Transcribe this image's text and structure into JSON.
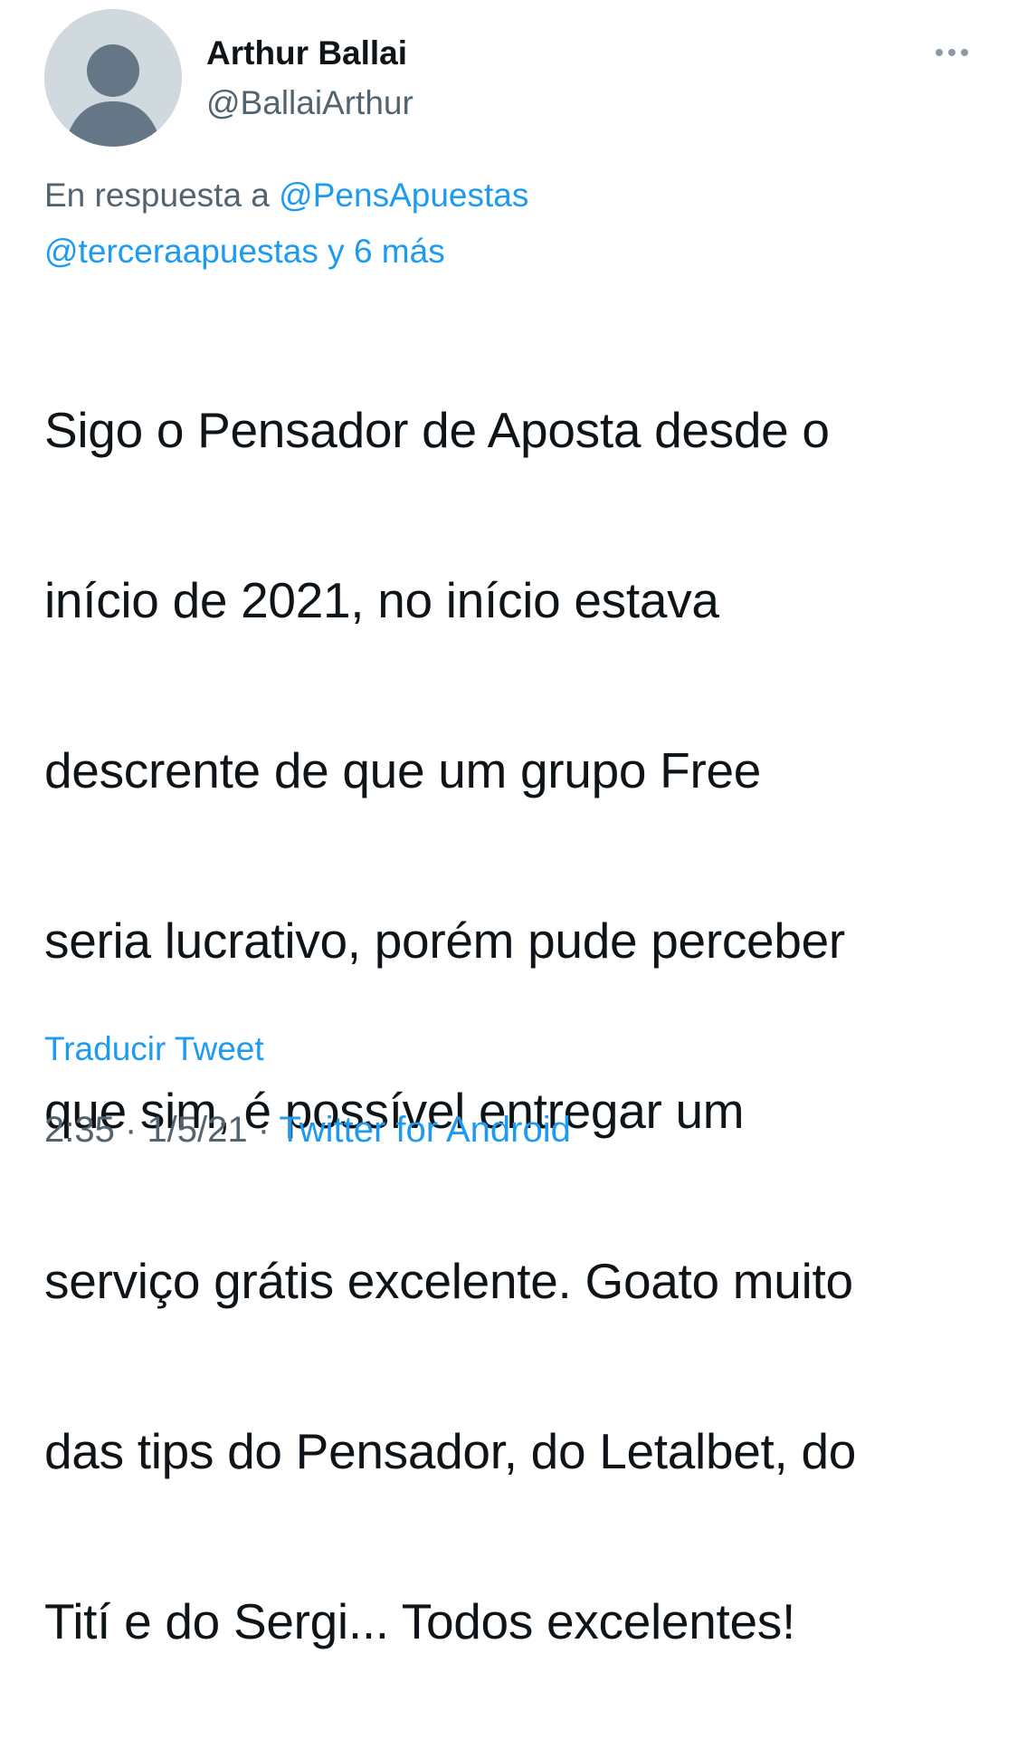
{
  "author": {
    "display_name": "Arthur Ballai",
    "handle": "@BallaiArthur",
    "avatar_icon": "default-profile-icon"
  },
  "menu": {
    "more_icon": "more-horizontal-icon"
  },
  "reply_context": {
    "prefix": "En respuesta a",
    "mention_1": "@PensApuestas",
    "mention_2": "@terceraapuestas",
    "connector": "y",
    "others": "6 más"
  },
  "tweet": {
    "lines": [
      "Sigo o Pensador de Aposta desde o",
      "início de 2021, no início estava",
      "descrente de que um grupo Free",
      "seria lucrativo, porém pude perceber",
      "que sim, é possível entregar um",
      "serviço grátis excelente. Goato muito",
      "das tips do Pensador, do Letalbet, do",
      "Tití e do Sergi... Todos excelentes!"
    ],
    "translate_label": "Traducir Tweet"
  },
  "meta": {
    "time": "2:35",
    "separator": "·",
    "date": "1/5/21",
    "source": "Twitter for Android"
  },
  "colors": {
    "accent": "#1d9bf0",
    "secondary_text": "#536471",
    "primary_text": "#0f1419",
    "avatar_bg": "#cfd9de",
    "avatar_fg": "#657786"
  }
}
